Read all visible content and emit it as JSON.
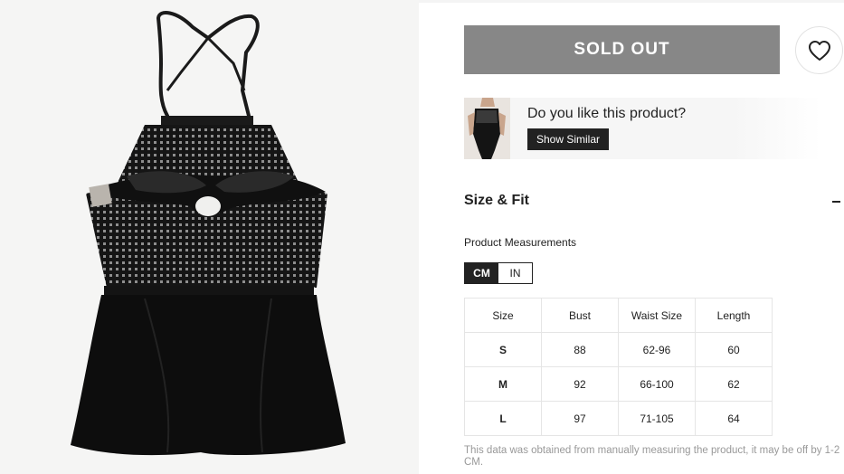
{
  "product_image": {
    "alt_icon": "swimsuit-photo"
  },
  "actions": {
    "sold_out_label": "SOLD OUT",
    "wishlist_icon": "heart-icon"
  },
  "similar": {
    "question": "Do you like this product?",
    "button_label": "Show Similar"
  },
  "size_fit": {
    "title": "Size & Fit",
    "measurements_label": "Product Measurements",
    "units": {
      "cm": "CM",
      "in": "IN",
      "selected": "CM"
    },
    "table": {
      "headers": [
        "Size",
        "Bust",
        "Waist Size",
        "Length"
      ],
      "rows": [
        [
          "S",
          "88",
          "62-96",
          "60"
        ],
        [
          "M",
          "92",
          "66-100",
          "62"
        ],
        [
          "L",
          "97",
          "71-105",
          "64"
        ]
      ]
    },
    "note": "This data was obtained from manually measuring the product, it may be off by 1-2 CM."
  },
  "colors": {
    "sold_out_bg": "#878787",
    "dark": "#222222",
    "note_text": "#999999"
  }
}
